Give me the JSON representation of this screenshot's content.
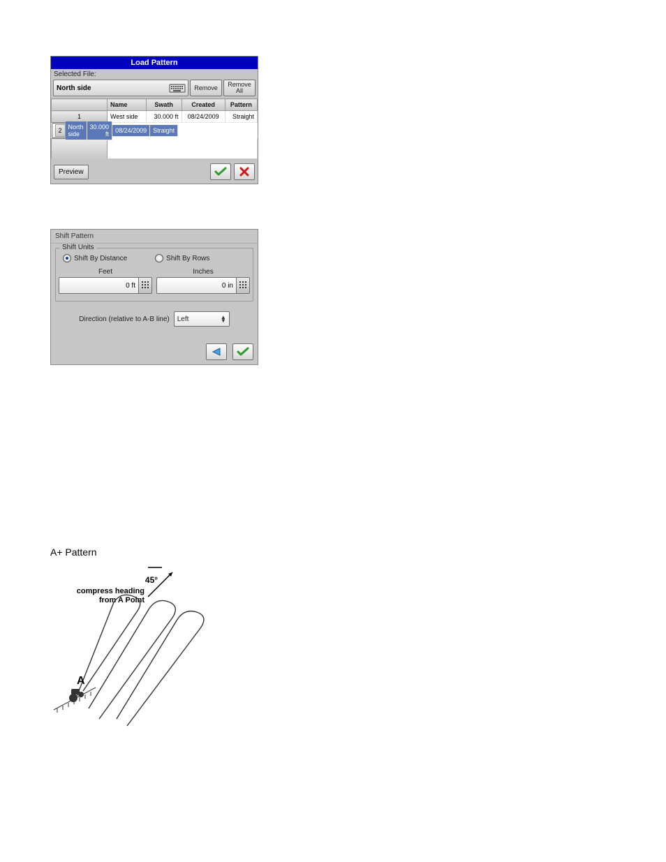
{
  "load_pattern": {
    "title": "Load Pattern",
    "selected_file_label": "Selected File:",
    "selected_file_value": "North side",
    "remove_label": "Remove",
    "remove_all_line1": "Remove",
    "remove_all_line2": "All",
    "columns": {
      "name": "Name",
      "swath": "Swath",
      "created": "Created",
      "pattern": "Pattern"
    },
    "rows": [
      {
        "n": "1",
        "name": "West side",
        "swath": "30.000 ft",
        "created": "08/24/2009",
        "pattern": "Straight"
      },
      {
        "n": "2",
        "name": "North side",
        "swath": "30.000 ft",
        "created": "08/24/2009",
        "pattern": "Straight"
      }
    ],
    "preview_label": "Preview"
  },
  "shift_pattern": {
    "title": "Shift Pattern",
    "units_legend": "Shift Units",
    "radio_distance": "Shift By Distance",
    "radio_rows": "Shift By Rows",
    "col_feet": "Feet",
    "col_inches": "Inches",
    "val_feet": "0 ft",
    "val_inches": "0 in",
    "direction_label": "Direction (relative to A-B line)",
    "direction_value": "Left"
  },
  "aplus": {
    "heading": "A+ Pattern",
    "angle": "45°",
    "caption_l1": "compress heading",
    "caption_l2": "from A Point",
    "point_label": "A"
  }
}
